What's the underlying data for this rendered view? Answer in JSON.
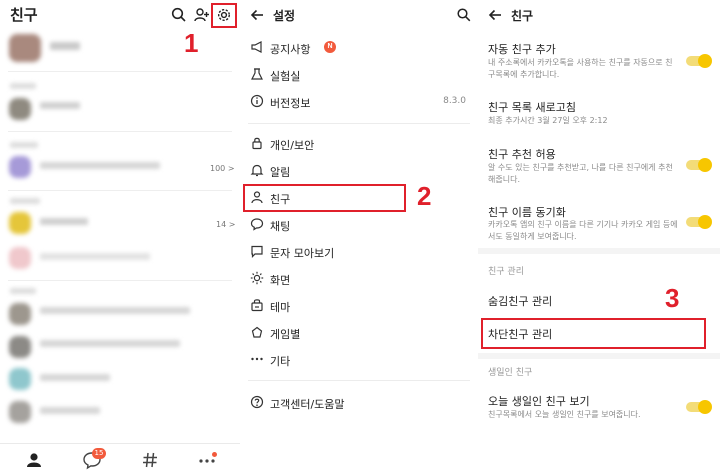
{
  "friends_panel": {
    "title": "친구",
    "friend_counts": [
      "100 >",
      "14 >"
    ],
    "tab_chat_badge": "15",
    "step": "1"
  },
  "settings_panel": {
    "title": "설정",
    "items": [
      {
        "label": "공지사항",
        "icon": "megaphone-icon"
      },
      {
        "label": "실험실",
        "icon": "flask-icon"
      },
      {
        "label": "버전정보",
        "icon": "info-icon",
        "value": "8.3.0"
      },
      {
        "label": "개인/보안",
        "icon": "lock-icon"
      },
      {
        "label": "알림",
        "icon": "bell-icon"
      },
      {
        "label": "친구",
        "icon": "person-icon"
      },
      {
        "label": "채팅",
        "icon": "chat-bubble-icon"
      },
      {
        "label": "문자 모아보기",
        "icon": "message-icon"
      },
      {
        "label": "화면",
        "icon": "brightness-icon"
      },
      {
        "label": "테마",
        "icon": "theme-icon"
      },
      {
        "label": "게임별",
        "icon": "game-icon"
      },
      {
        "label": "기타",
        "icon": "more-dots-icon"
      },
      {
        "label": "고객센터/도움말",
        "icon": "help-icon"
      }
    ],
    "new_badge": "N",
    "step": "2"
  },
  "friend_settings_panel": {
    "title": "친구",
    "settings": [
      {
        "title": "자동 친구 추가",
        "desc": "내 주소록에서 카카오톡을 사용하는 친구를 자동으로 친구목록에 추가합니다.",
        "toggle_on": true
      },
      {
        "title": "친구 목록 새로고침",
        "desc": "최종 추가시간 3월 27일 오후 2:12"
      },
      {
        "title": "친구 추천 허용",
        "desc": "알 수도 있는 친구를 추천받고, 나를 다른 친구에게 추천해줍니다.",
        "toggle_on": true
      },
      {
        "title": "친구 이름 동기화",
        "desc": "카카오톡 앱의 친구 이름을 다른 기기나 카카오 게임 등에서도 동일하게 보여줍니다.",
        "toggle_on": true
      }
    ],
    "section_manage": "친구 관리",
    "hidden_friends": "숨김친구 관리",
    "blocked_friends": "차단친구 관리",
    "section_birthday": "생일인 친구",
    "birthday_title": "오늘 생일인 친구 보기",
    "birthday_desc": "친구목록에서 오늘 생일인 친구를 보여줍니다.",
    "birthday_toggle_on": true,
    "step": "3"
  },
  "colors": {
    "accent_red": "#e0202b",
    "toggle_yellow": "#f7c600",
    "badge_orange": "#f25a3c"
  }
}
